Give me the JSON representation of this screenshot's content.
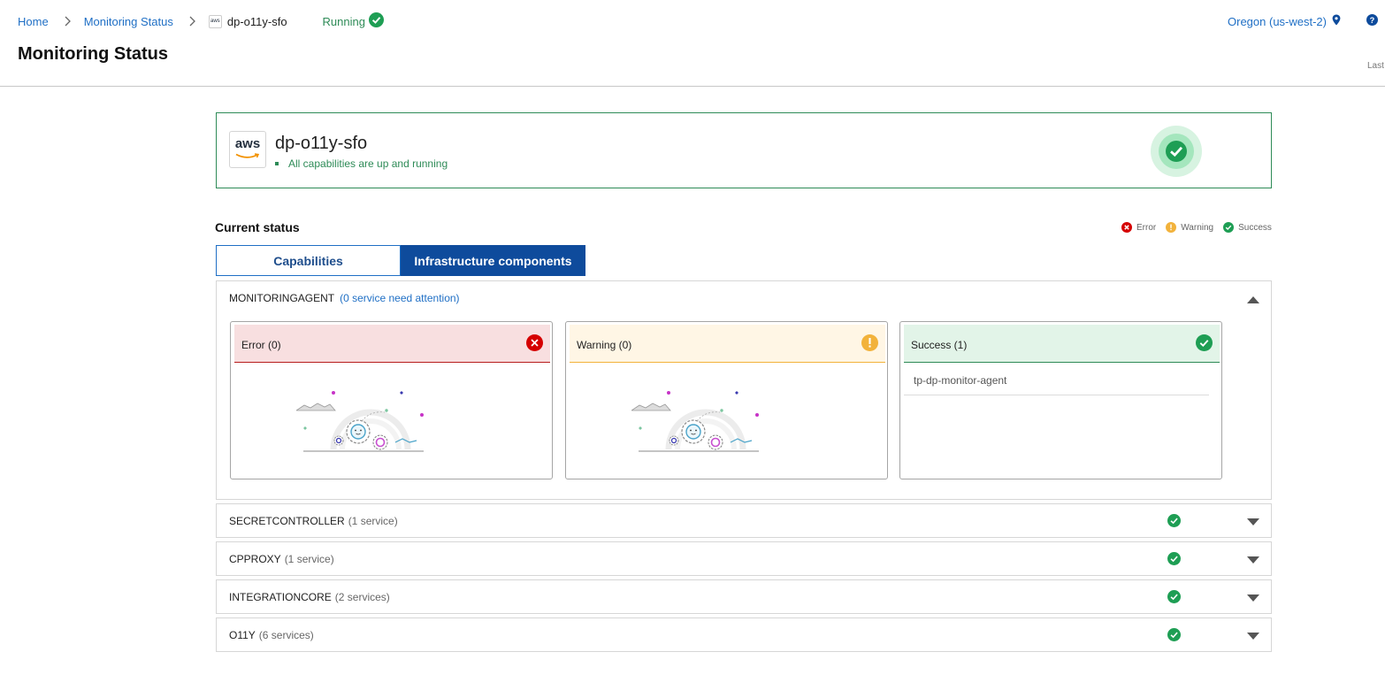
{
  "breadcrumb": {
    "home": "Home",
    "monitoring": "Monitoring Status",
    "current": "dp-o11y-sfo",
    "aws_mini_label": "aws",
    "status": "Running"
  },
  "header": {
    "region": "Oregon (us-west-2)",
    "title": "Monitoring Status",
    "last_label": "Last"
  },
  "summary": {
    "logo_text": "aws",
    "name": "dp-o11y-sfo",
    "message": "All capabilities are up and running"
  },
  "current_status": {
    "title": "Current status",
    "legend": {
      "error": "Error",
      "warning": "Warning",
      "success": "Success"
    }
  },
  "tabs": [
    {
      "label": "Capabilities",
      "active": false
    },
    {
      "label": "Infrastructure components",
      "active": true
    }
  ],
  "components": {
    "monitoringagent": {
      "name": "MONITORINGAGENT",
      "attention": "(0 service need attention)",
      "error_label": "Error (0)",
      "warning_label": "Warning (0)",
      "success_label": "Success (1)",
      "success_items": [
        "tp-dp-monitor-agent"
      ]
    },
    "collapsed": [
      {
        "name": "SECRETCONTROLLER",
        "count": "(1 service)"
      },
      {
        "name": "CPPROXY",
        "count": "(1 service)"
      },
      {
        "name": "INTEGRATIONCORE",
        "count": "(2 services)"
      },
      {
        "name": "O11Y",
        "count": "(6 services)"
      }
    ]
  },
  "colors": {
    "link": "#1f6fc5",
    "tab_active": "#0e4b9c",
    "success": "#1e9e54",
    "error": "#d50000",
    "warning": "#f2b23b"
  },
  "icons": [
    "chevron-right-icon",
    "check-circle-icon",
    "location-pin-icon",
    "help-icon",
    "error-icon",
    "warning-icon",
    "success-icon",
    "caret-up-icon",
    "caret-down-icon"
  ]
}
